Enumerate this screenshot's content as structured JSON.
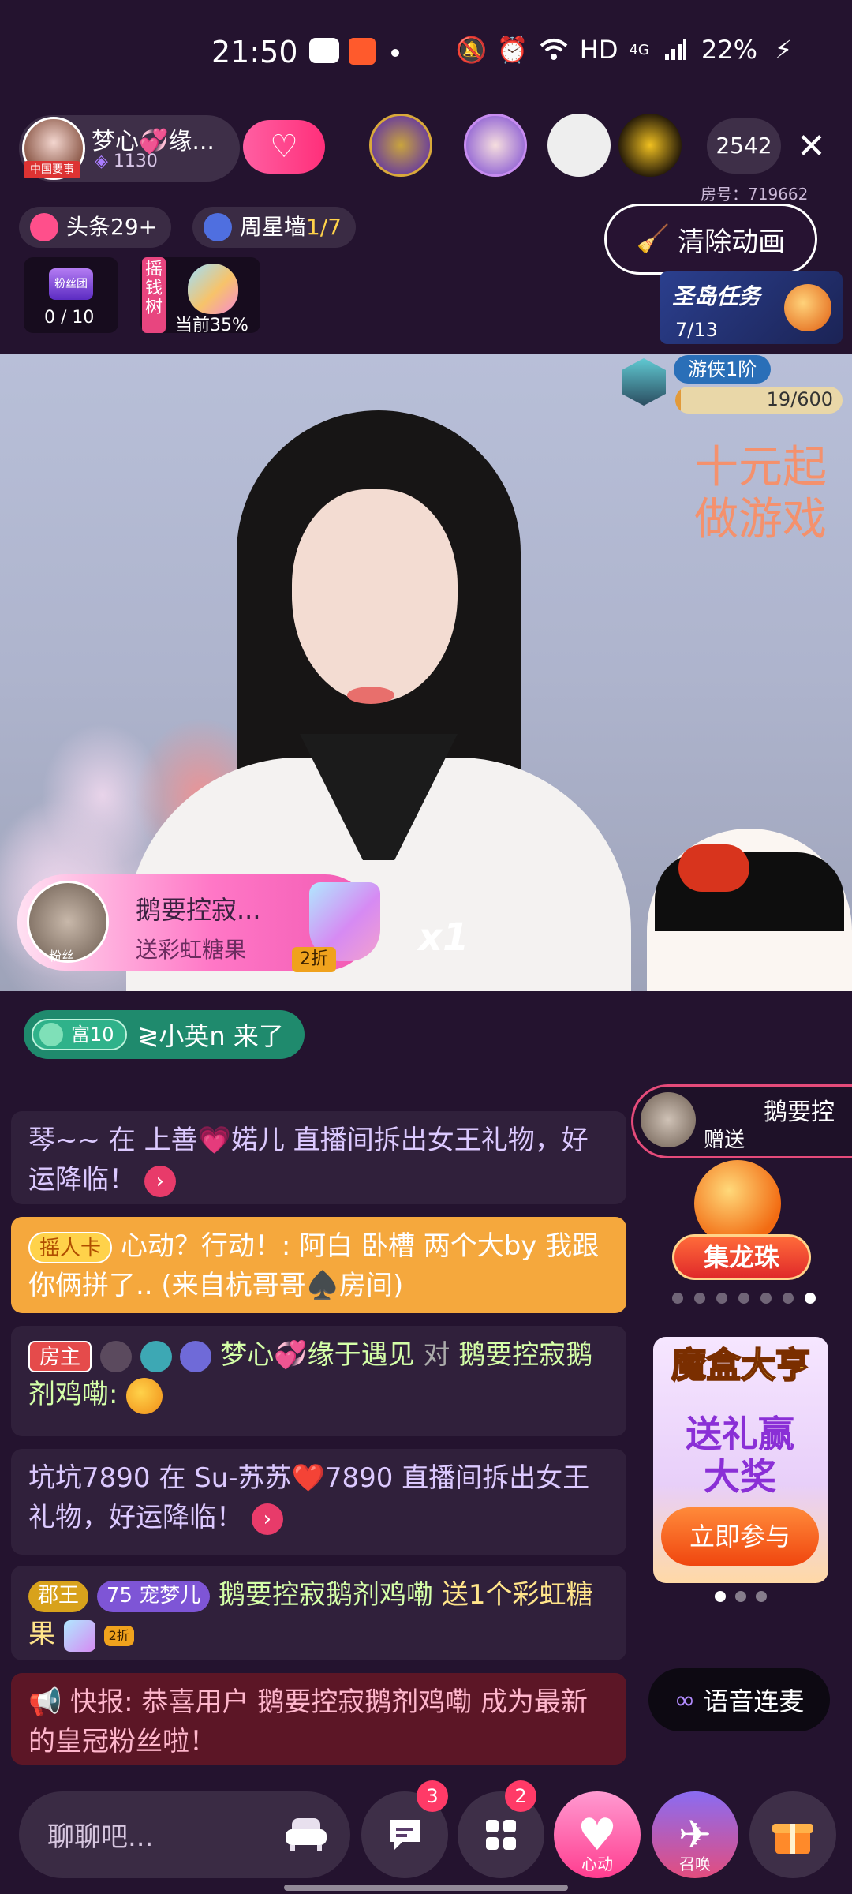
{
  "status_bar": {
    "time": "21:50",
    "network": "HD",
    "signal": "4G",
    "battery": "22%",
    "icons": [
      "wechat-icon",
      "app-notify-icon",
      "dot-icon",
      "mute-icon",
      "alarm-icon",
      "wifi-icon",
      "signal-icon",
      "charging-icon"
    ]
  },
  "header": {
    "host_name": "梦心💞缘...",
    "host_tag": "中国要事",
    "host_fans": "1130",
    "viewer_count": "2542",
    "room_number": "房号：719662"
  },
  "row2": {
    "headline": "头条29+",
    "star_wall_prefix": "周星墙",
    "star_wall_count": "1/7",
    "clear_animation": "清除动画"
  },
  "tasks": {
    "task_icon_label": "粉丝团",
    "task_count": "0 / 10",
    "tree_tag": "摇钱树",
    "tree_progress": "当前35%",
    "island_title": "圣岛任务",
    "island_count": "7/13"
  },
  "rank": {
    "label": "游侠1阶",
    "progress_text": "19/600",
    "progress_fraction": 0.032
  },
  "video": {
    "watermark_line1": "十元起",
    "watermark_line2": "做游戏"
  },
  "gift_banner": {
    "user": "鹅要控寂...",
    "fan_tag": "粉丝",
    "action": "送彩虹糖果",
    "discount": "2折",
    "multiplier": "x1"
  },
  "join_notice": {
    "level": "富10",
    "text": "≷小英n 来了"
  },
  "chat": [
    {
      "id": 1,
      "text": "琴~~ 在 上善💗婼儿 直播间拆出女王礼物，好运降临！"
    },
    {
      "id": 2,
      "tag": "摇人卡",
      "text": "心动？行动！: 阿白 卧槽 两个大by 我跟你俩拼了.. (来自杭哥哥♠️房间)"
    },
    {
      "id": 3,
      "tag": "房主",
      "name": "梦心💞缘于遇见",
      "mid": "对",
      "target": "鹅要控寂鹅剂鸡嘞:"
    },
    {
      "id": 4,
      "text": "坑坑7890 在 Su-苏苏❤️7890 直播间拆出女王礼物，好运降临！"
    },
    {
      "id": 5,
      "tag1": "郡王",
      "tag2_num": "75",
      "tag2": "宠梦儿",
      "name": "鹅要控寂鹅剂鸡嘞",
      "action": "送1个彩虹糖果",
      "disc": "2折"
    },
    {
      "id": 6,
      "text": "快报: 恭喜用户 鹅要控寂鹅剂鸡嘞 成为最新的皇冠粉丝啦！"
    }
  ],
  "side": {
    "gift_name": "鹅要控",
    "gift_sub": "赠送",
    "dragon_label": "集龙珠",
    "box_title": "魔盒大亨",
    "box_sub": "送礼赢大奖",
    "box_button": "立即参与",
    "voice_link": "语音连麦"
  },
  "bottom_bar": {
    "placeholder": "聊聊吧...",
    "chat_badge": "3",
    "apps_badge": "2",
    "heart_label": "心动",
    "summon_label": "召唤"
  },
  "colors": {
    "background": "#24132f",
    "accent_pink": "#ff2f7a",
    "join_green": "#1f8a6d",
    "card_orange": "#f5a83d"
  }
}
